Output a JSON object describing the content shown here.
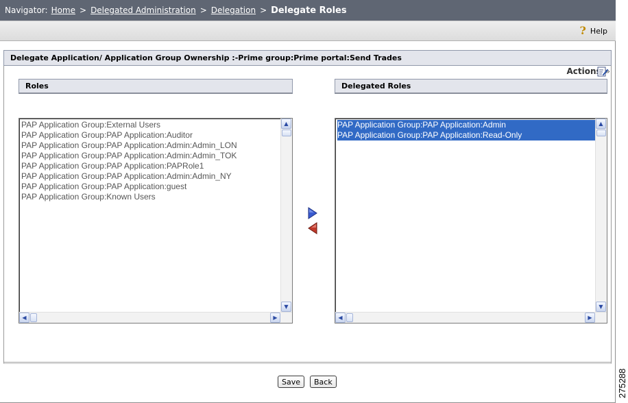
{
  "navigator": {
    "label": "Navigator:",
    "crumbs": [
      "Home",
      "Delegated Administration",
      "Delegation"
    ],
    "separator": ">",
    "current": "Delegate Roles"
  },
  "help": {
    "label": "Help",
    "icon": "help-icon"
  },
  "page_title": "Delegate Application/ Application Group Ownership :-Prime group:Prime portal:Send Trades",
  "actions": {
    "label": "Actions",
    "chevron": "»",
    "icon": "edit-icon"
  },
  "roles": {
    "header": "Roles",
    "items": [
      "PAP Application Group:External Users",
      "PAP Application Group:PAP Application:Auditor",
      "PAP Application Group:PAP Application:Admin:Admin_LON",
      "PAP Application Group:PAP Application:Admin:Admin_TOK",
      "PAP Application Group:PAP Application:PAPRole1",
      "PAP Application Group:PAP Application:Admin:Admin_NY",
      "PAP Application Group:PAP Application:guest",
      "PAP Application Group:Known Users"
    ]
  },
  "delegated_roles": {
    "header": "Delegated Roles",
    "items": [
      "PAP Application Group:PAP Application:Admin",
      "PAP Application Group:PAP Application:Read-Only"
    ]
  },
  "buttons": {
    "save": "Save",
    "back": "Back"
  },
  "figure_id": "275288",
  "colors": {
    "nav_bg": "#5f6673",
    "selection": "#316ac5",
    "add_arrow": "#3a5bd0",
    "remove_arrow": "#c0392b"
  }
}
